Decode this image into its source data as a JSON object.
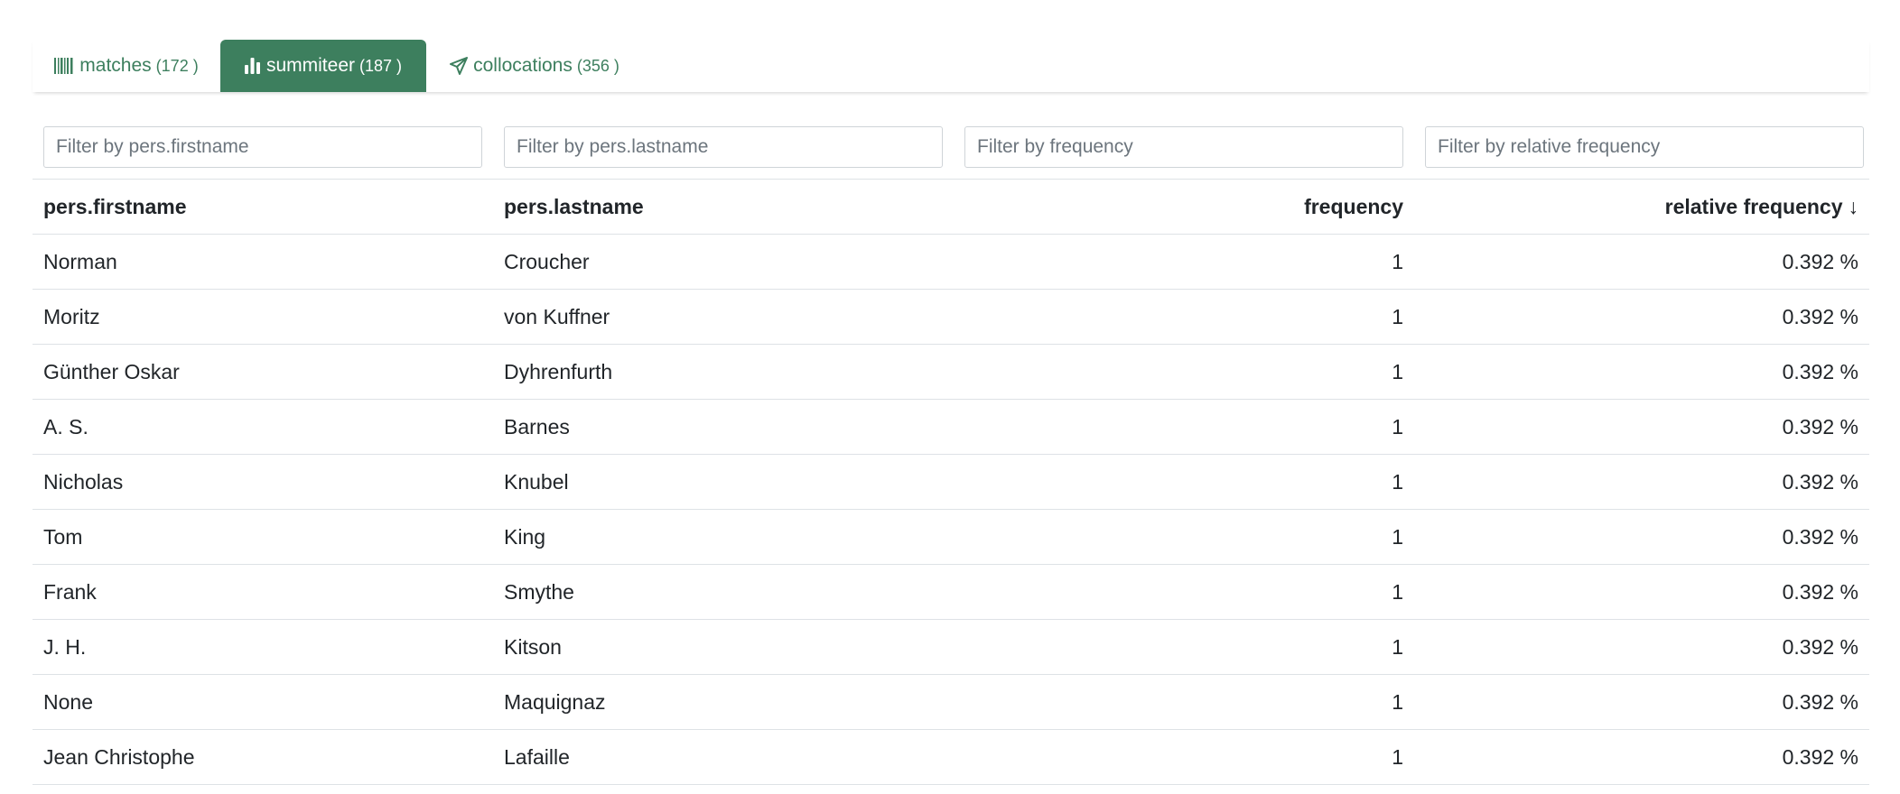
{
  "tabs": [
    {
      "label": "matches",
      "count": "(172 )",
      "icon": "barcode-icon",
      "active": false
    },
    {
      "label": "summiteer",
      "count": "(187 )",
      "icon": "bar-chart-icon",
      "active": true
    },
    {
      "label": "collocations",
      "count": "(356 )",
      "icon": "paper-plane-icon",
      "active": false
    }
  ],
  "filters": {
    "firstname_placeholder": "Filter by pers.firstname",
    "lastname_placeholder": "Filter by pers.lastname",
    "frequency_placeholder": "Filter by frequency",
    "relfreq_placeholder": "Filter by relative frequency"
  },
  "table": {
    "headers": [
      "pers.firstname",
      "pers.lastname",
      "frequency",
      "relative frequency"
    ],
    "sort_indicator": "↓",
    "rows": [
      [
        "Norman",
        "Croucher",
        "1",
        "0.392 %"
      ],
      [
        "Moritz",
        "von Kuffner",
        "1",
        "0.392 %"
      ],
      [
        "Günther Oskar",
        "Dyhrenfurth",
        "1",
        "0.392 %"
      ],
      [
        "A. S.",
        "Barnes",
        "1",
        "0.392 %"
      ],
      [
        "Nicholas",
        "Knubel",
        "1",
        "0.392 %"
      ],
      [
        "Tom",
        "King",
        "1",
        "0.392 %"
      ],
      [
        "Frank",
        "Smythe",
        "1",
        "0.392 %"
      ],
      [
        "J. H.",
        "Kitson",
        "1",
        "0.392 %"
      ],
      [
        "None",
        "Maquignaz",
        "1",
        "0.392 %"
      ],
      [
        "Jean Christophe",
        "Lafaille",
        "1",
        "0.392 %"
      ]
    ]
  },
  "colors": {
    "accent": "#3d7f5e",
    "border": "#dee2e6"
  }
}
